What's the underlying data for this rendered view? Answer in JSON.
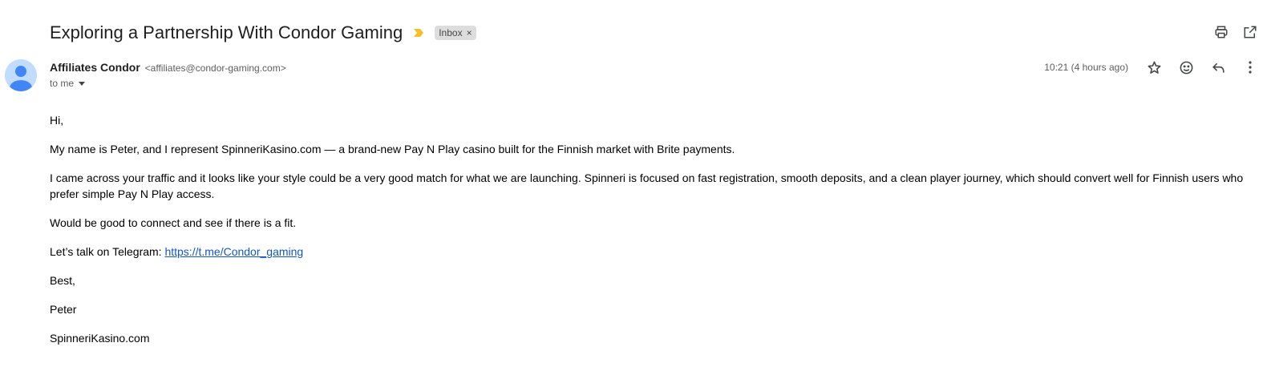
{
  "email": {
    "subject": "Exploring a Partnership With Condor Gaming",
    "label": "Inbox",
    "sender_name": "Affiliates Condor",
    "sender_email": "<affiliates@condor-gaming.com>",
    "recipient": "to me",
    "timestamp": "10:21 (4 hours ago)"
  },
  "body": {
    "greeting": "Hi,",
    "p1": "My name is Peter, and I represent SpinneriKasino.com — a brand-new Pay N Play casino built for the Finnish market with Brite payments.",
    "p2": "I came across your traffic and it looks like your style could be a very good match for what we are launching. Spinneri is focused on fast registration, smooth deposits, and a clean player journey, which should convert well for Finnish users who prefer simple Pay N Play access.",
    "p3": "Would be good to connect and see if there is a fit.",
    "p4_prefix": "Let’s talk on Telegram: ",
    "p4_link": "https://t.me/Condor_gaming",
    "signoff": "Best,",
    "signature_name": "Peter",
    "signature_site": "SpinneriKasino.com"
  },
  "icons": {
    "importance": "importance-marker-icon",
    "label_remove": "close-icon",
    "print": "print-icon",
    "new_window": "open-in-new-window-icon",
    "avatar": "person-icon",
    "star": "star-icon",
    "emoji": "emoji-icon",
    "reply": "reply-icon",
    "more": "more-vertical-icon",
    "recipient_dropdown": "chevron-down-icon"
  },
  "colors": {
    "importance": "#f6bf26",
    "link": "#1155cc",
    "chip_bg": "#dddddd",
    "avatar_bg": "#c2dcff",
    "avatar_fg": "#4285f4"
  }
}
